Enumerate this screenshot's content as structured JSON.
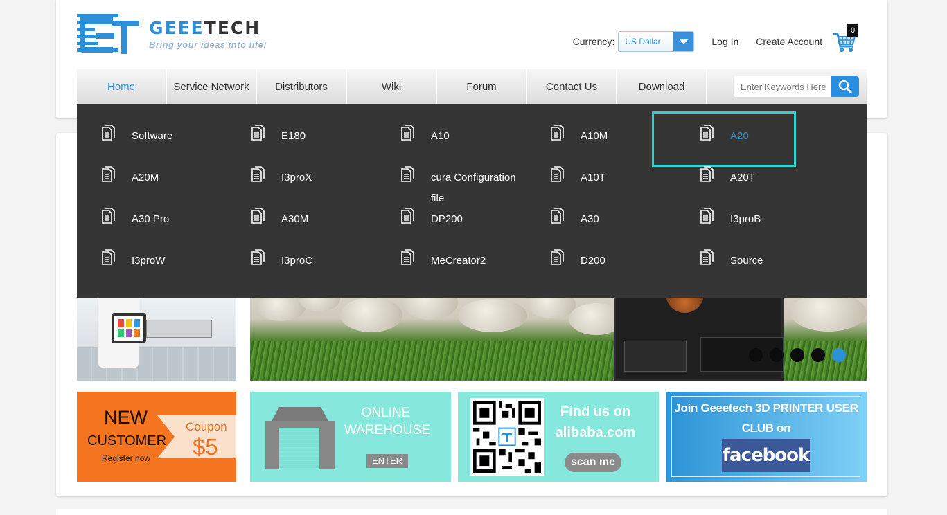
{
  "header": {
    "brand_blue": "GEEE",
    "brand_dark": "TECH",
    "tagline": "Bring your ideas into life!",
    "currency_label": "Currency:",
    "currency_value": "US Dollar",
    "login": "Log In",
    "create_account": "Create Account",
    "cart_count": "0"
  },
  "nav": {
    "items": [
      {
        "label": "Home",
        "active": true
      },
      {
        "label": "Service Network"
      },
      {
        "label": "Distributors"
      },
      {
        "label": "Wiki"
      },
      {
        "label": "Forum"
      },
      {
        "label": "Contact Us"
      },
      {
        "label": "Download"
      },
      {
        "label": ""
      }
    ],
    "search_placeholder": "Enter Keywords Here"
  },
  "dropdown": {
    "items": [
      "Software",
      "E180",
      "A10",
      "A10M",
      "A20",
      "A20M",
      "I3proX",
      "cura Configuration file",
      "A10T",
      "A20T",
      "A30 Pro",
      "A30M",
      "DP200",
      "A30",
      "I3proB",
      "I3proW",
      "I3proC",
      "MeCreator2",
      "D200",
      "Source"
    ],
    "highlighted": "A20"
  },
  "banner": {
    "slides": 5,
    "active_slide": 5
  },
  "promos": {
    "new_customer": {
      "new": "NEW",
      "customer": "CUSTOMER",
      "register": "Register now",
      "coupon_label": "Coupon",
      "coupon_price": "$5"
    },
    "warehouse": {
      "title": "ONLINE WAREHOUSE",
      "enter": "ENTER"
    },
    "alibaba": {
      "title": "Find us on alibaba.com",
      "scan": "scan me"
    },
    "facebook": {
      "text": "Join Geeetech 3D PRINTER USER CLUB on",
      "brand": "facebook"
    }
  },
  "colors": {
    "accent": "#2d8fd6",
    "dropdown_bg": "#353535",
    "highlight": "#2bd2d0",
    "promo_orange": "#f5741f",
    "promo_teal": "#86e8dc"
  }
}
